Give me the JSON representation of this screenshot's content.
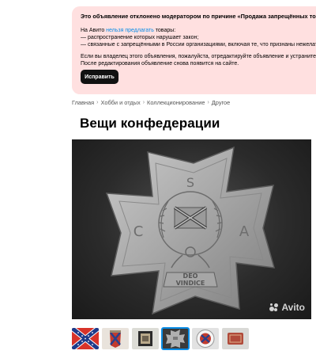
{
  "notice": {
    "title": "Это объявление отклонено модератором по причине «Продажа запрещённых товаров»",
    "intro_prefix": "На Авито ",
    "intro_link": "нельзя предлагать",
    "intro_suffix": " товары:",
    "bullet_1": "— распространение которых нарушает закон;",
    "bullet_2": "— связанные с запрещёнными в России организациями, включая те, что признаны нежелательными",
    "owner_text": "Если вы владелец этого объявления, пожалуйста, отредактируйте объявление и устраните нарушения.",
    "after_edit": "После редактирования объявление снова появится на сайте.",
    "fix_button": "Исправить",
    "colors": {
      "background": "#ffe0e0",
      "link": "#0a8de6",
      "button": "#111111"
    }
  },
  "breadcrumb": {
    "items": [
      "Главная",
      "Хобби и отдых",
      "Коллекционирование",
      "Другое"
    ],
    "separator": "›"
  },
  "listing": {
    "title": "Вещи конфедерации"
  },
  "photo": {
    "badge_letters_top": "S",
    "badge_letter_left": "C",
    "badge_letter_right": "A",
    "badge_motto_1": "DEO",
    "badge_motto_2": "VINDICE",
    "watermark": "Avito"
  },
  "thumbnails": [
    {
      "icon": "confederate-flag-thumbnail"
    },
    {
      "icon": "flag-pin-thumbnail"
    },
    {
      "icon": "framed-item-thumbnail"
    },
    {
      "icon": "cross-badge-thumbnail",
      "active": true
    },
    {
      "icon": "round-badge-thumbnail"
    },
    {
      "icon": "buckle-thumbnail"
    }
  ]
}
